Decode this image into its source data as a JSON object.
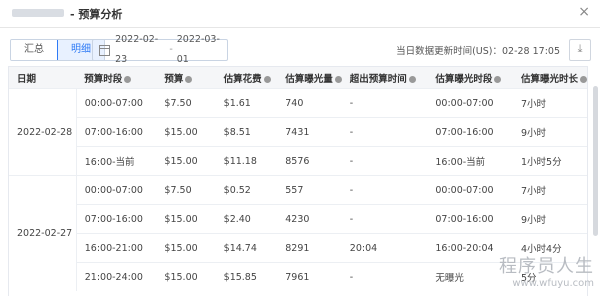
{
  "dialog": {
    "title": "- 预算分析",
    "close_glyph": "×"
  },
  "toolbar": {
    "tabs": [
      {
        "label": "汇总",
        "active": false
      },
      {
        "label": "明细",
        "active": true
      }
    ],
    "date_start": "2022-02-23",
    "date_sep": "-",
    "date_end": "2022-03-01",
    "updated_text": "当日数据更新时间(US)：02-28 17:05",
    "download_icon": "download-icon"
  },
  "table": {
    "headers": [
      "日期",
      "预算时段",
      "预算",
      "估算花费",
      "估算曝光量",
      "超出预算时间",
      "估算曝光时段",
      "估算曝光时长"
    ],
    "groups": [
      {
        "date": "2022-02-28",
        "rows": [
          [
            "00:00-07:00",
            "$7.50",
            "$1.61",
            "740",
            "-",
            "00:00-07:00",
            "7小时"
          ],
          [
            "07:00-16:00",
            "$15.00",
            "$8.51",
            "7431",
            "-",
            "07:00-16:00",
            "9小时"
          ],
          [
            "16:00-当前",
            "$15.00",
            "$11.18",
            "8576",
            "-",
            "16:00-当前",
            "1小时5分"
          ]
        ]
      },
      {
        "date": "2022-02-27",
        "rows": [
          [
            "00:00-07:00",
            "$7.50",
            "$0.52",
            "557",
            "-",
            "00:00-07:00",
            "7小时"
          ],
          [
            "07:00-16:00",
            "$15.00",
            "$2.40",
            "4230",
            "-",
            "07:00-16:00",
            "9小时"
          ],
          [
            "16:00-21:00",
            "$15.00",
            "$14.74",
            "8291",
            "20:04",
            "16:00-20:04",
            "4小时4分"
          ],
          [
            "21:00-24:00",
            "$15.00",
            "$15.85",
            "7961",
            "-",
            "无曝光",
            "5分"
          ]
        ]
      }
    ]
  },
  "watermark": {
    "line1": "程序员人生",
    "line2": "www.wfuyu.com"
  }
}
